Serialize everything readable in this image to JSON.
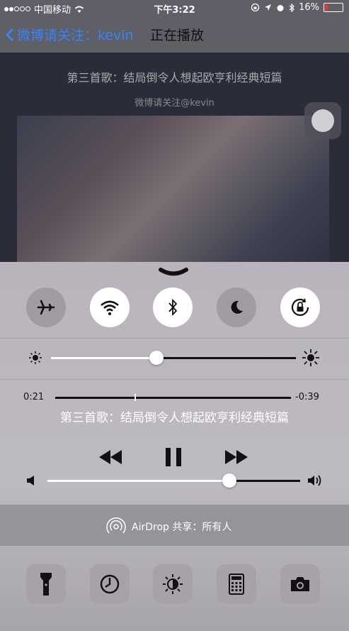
{
  "status_bar": {
    "carrier": "中国移动",
    "time": "下午3:22",
    "battery": "16%"
  },
  "nav": {
    "back_label": "微博请关注：kevin",
    "title": "正在播放"
  },
  "player": {
    "song_title": "第三首歌：结局倒令人想起欧亨利经典短篇",
    "subtitle": "微博请关注@kevin"
  },
  "control_center": {
    "toggles": [
      {
        "name": "airplane-mode",
        "on": false
      },
      {
        "name": "wifi",
        "on": true
      },
      {
        "name": "bluetooth",
        "on": true
      },
      {
        "name": "do-not-disturb",
        "on": false
      },
      {
        "name": "rotation-lock",
        "on": true
      }
    ],
    "brightness_level": 0.43,
    "playback": {
      "elapsed": "0:21",
      "remaining": "-0:39",
      "progress": 0.34,
      "song_title": "第三首歌：结局倒令人想起欧亨利经典短篇"
    },
    "volume_level": 0.72,
    "airdrop_label": "AirDrop 共享：所有人",
    "shortcuts": [
      "flashlight-icon",
      "timer-icon",
      "night-shift-icon",
      "calculator-icon",
      "camera-icon"
    ]
  }
}
